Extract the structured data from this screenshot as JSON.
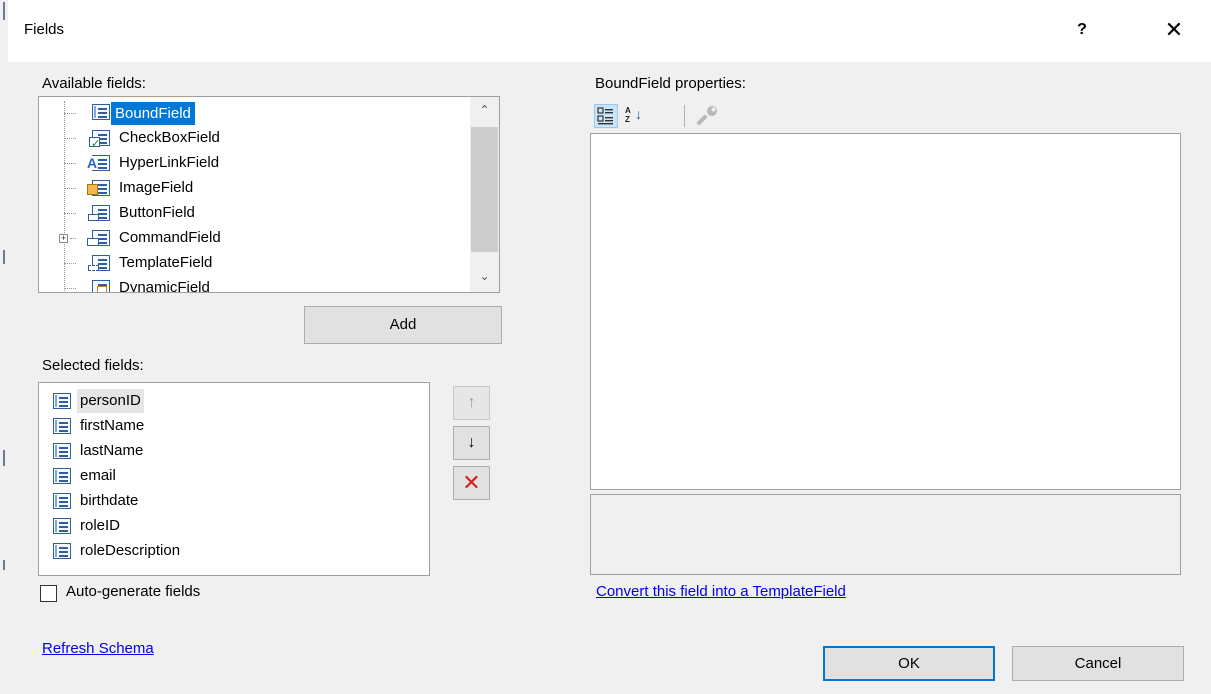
{
  "dialog": {
    "title": "Fields",
    "help_label": "?",
    "close_label": "✕"
  },
  "available": {
    "label": "Available fields:",
    "items": [
      {
        "label": "BoundField",
        "icon": "bound-field-icon",
        "selected": true
      },
      {
        "label": "CheckBoxField",
        "icon": "checkbox-field-icon"
      },
      {
        "label": "HyperLinkField",
        "icon": "hyperlink-field-icon"
      },
      {
        "label": "ImageField",
        "icon": "image-field-icon"
      },
      {
        "label": "ButtonField",
        "icon": "button-field-icon"
      },
      {
        "label": "CommandField",
        "icon": "command-field-icon",
        "expandable": true
      },
      {
        "label": "TemplateField",
        "icon": "template-field-icon"
      },
      {
        "label": "DynamicField",
        "icon": "dynamic-field-icon"
      }
    ],
    "expander_glyph": "+",
    "scroll_up": "⌃",
    "scroll_down": "⌄"
  },
  "add_button": "Add",
  "selected": {
    "label": "Selected fields:",
    "items": [
      "personID",
      "firstName",
      "lastName",
      "email",
      "birthdate",
      "roleID",
      "roleDescription"
    ],
    "move_up_glyph": "↑",
    "move_down_glyph": "↓",
    "delete_glyph": "✕"
  },
  "auto_generate": {
    "label": "Auto-generate fields",
    "checked": false
  },
  "refresh_schema": "Refresh Schema",
  "properties": {
    "label": "BoundField properties:",
    "toolbar": [
      "categorized-icon",
      "alphabetical-icon",
      "property-pages-icon"
    ],
    "sort_glyph": "A Z",
    "sort_arrow": "↓"
  },
  "convert_link": "Convert this field into a TemplateField",
  "ok_button": "OK",
  "cancel_button": "Cancel",
  "colors": {
    "selection": "#0078d7",
    "link": "#0000ee",
    "delete": "#d21f1f"
  }
}
